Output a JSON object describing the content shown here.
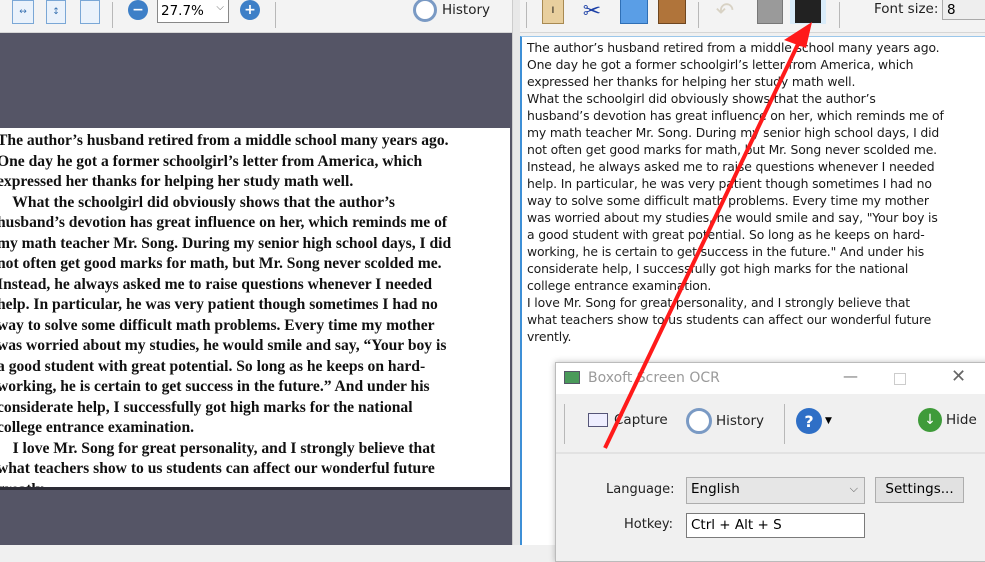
{
  "left_toolbar": {
    "zoom_value": "27.7%",
    "history_label": "History"
  },
  "document_page": {
    "lines": [
      "The author’s husband retired from a middle school many years ago.",
      "One day he got a former schoolgirl’s letter from America, which",
      "expressed her thanks for helping her study math well.",
      "    What the schoolgirl did obviously shows that the author’s",
      "husband’s devotion has great influence on her, which reminds me of",
      "my math teacher Mr. Song. During my senior high school days, I did",
      "not often get good marks for math, but Mr. Song never scolded me.",
      "Instead, he always asked me to raise questions whenever I needed",
      "help. In particular, he was very patient though sometimes I had no",
      "way to solve some difficult math problems. Every time my mother",
      "was worried about my studies, he would smile and say, “Your boy is",
      "a good student with great potential. So long as he keeps on hard-",
      "working, he is certain to get success in the future.” And under his",
      "considerate help, I successfully got high marks for the national",
      "college entrance examination.",
      "    I love Mr. Song for great personality, and I strongly believe that",
      "what teachers show to us students can affect our wonderful future",
      "greatly."
    ]
  },
  "right_toolbar": {
    "font_size_label": "Font size:",
    "font_size_value": "8"
  },
  "ocr_text": {
    "lines": [
      "The author’s husband retired from a middle school many years ago.",
      "One day he got a former schoolgirl’s letter from America, which",
      "expressed her thanks for helping her study math well.",
      "What the schoolgirl did obviously shows that the author’s",
      "husband’s devotion has great influence on her, which reminds me of",
      "my math teacher Mr. Song. During my senior high school days, I did",
      "not often get good marks for math, but Mr. Song never scolded me.",
      "Instead, he always asked me to raise questions whenever I needed",
      "help. In particular, he was very patient though sometimes I had no",
      "way to solve some difficult math problems. Every time my mother",
      "was worried about my studies, he would smile and say, \"Your boy is",
      "a good student with great potential. So long as he keeps on hard-",
      "working, he is certain to get success in the future.\" And under his",
      "considerate help, I successfully got high marks for the national",
      "college entrance examination.",
      "I love Mr. Song for great personality, and I strongly believe that",
      "what teachers show to us students can affect our wonderful future",
      "vrently."
    ]
  },
  "ocr_dialog": {
    "title": "Boxoft Screen OCR",
    "capture_label": "Capture",
    "history_label": "History",
    "hide_label": "Hide",
    "language_label": "Language:",
    "language_value": "English",
    "settings_label": "Settings...",
    "hotkey_label": "Hotkey:",
    "hotkey_value": "Ctrl + Alt + S"
  },
  "colors": {
    "annotation_arrow": "#ff1a1a",
    "viewer_background": "#555566",
    "selection_border": "#3d8fd6"
  }
}
